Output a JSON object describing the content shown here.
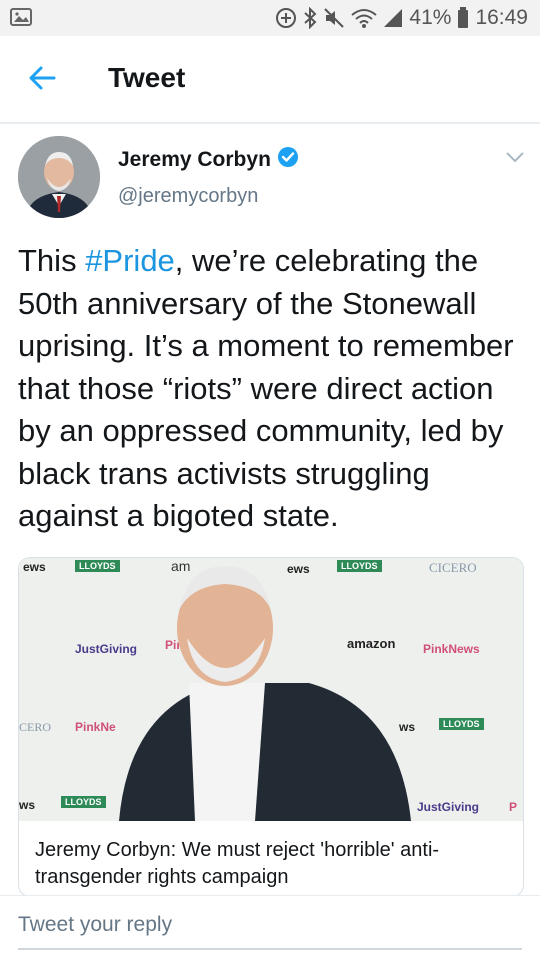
{
  "status_bar": {
    "battery": "41%",
    "time": "16:49"
  },
  "header": {
    "title": "Tweet"
  },
  "tweet": {
    "author_name": "Jeremy Corbyn",
    "author_handle": "@jeremycorbyn",
    "text_before": "This ",
    "hashtag": "#Pride",
    "text_after": ", we’re celebrating the 50th anniversary of the Stonewall uprising. It’s a moment to remem­ber that those “riots” were direct action by an oppressed com­munity, led by black trans activists struggling against a bigoted state."
  },
  "card": {
    "title": "Jeremy Corbyn: We must reject 'horrible' anti-transgender rights campaign",
    "backdrop_logos": [
      "ews",
      "LLOYDS",
      "am",
      "ews",
      "LLOYDS",
      "CICERO",
      "JustGiving",
      "Pink",
      "amazon",
      "PinkNews",
      "CERO",
      "PinkNe",
      "ws",
      "LLOYDS",
      "ws",
      "LLOYDS",
      "JustGiving",
      "P"
    ]
  },
  "reply": {
    "placeholder": "Tweet your reply"
  },
  "colors": {
    "accent": "#1da1f2",
    "hashtag": "#1b95e0",
    "verified": "#1da1f2",
    "lloyds_green": "#2e8b57"
  }
}
